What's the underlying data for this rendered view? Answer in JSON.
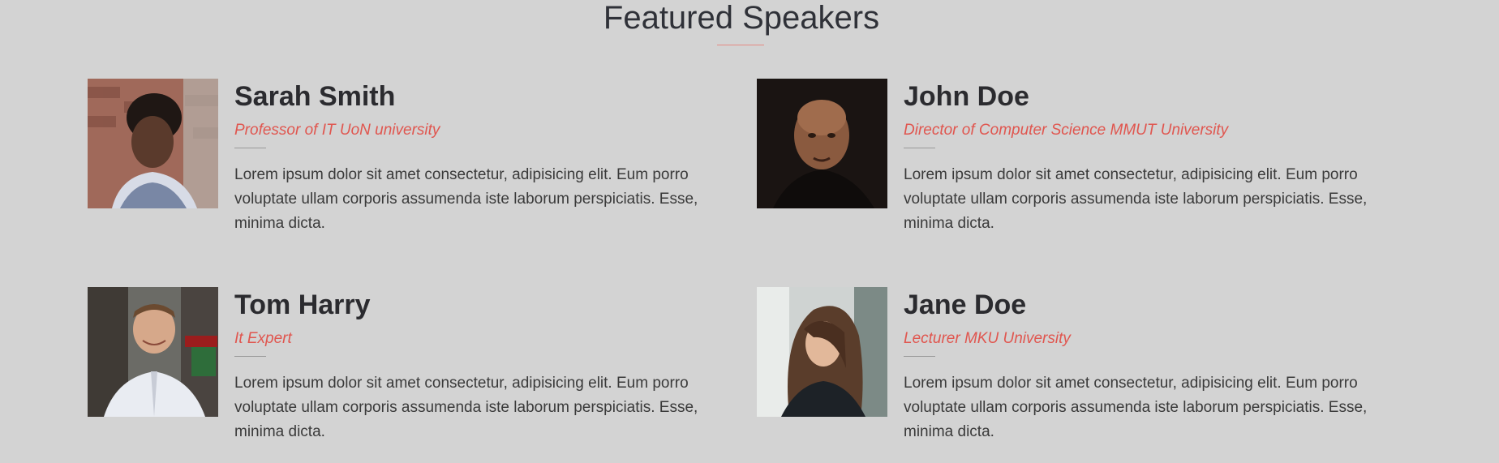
{
  "section": {
    "title": "Featured Speakers"
  },
  "speakers": [
    {
      "name": "Sarah Smith",
      "role": "Professor of IT UoN university",
      "bio": "Lorem ipsum dolor sit amet consectetur, adipisicing elit. Eum porro voluptate ullam corporis assumenda iste laborum perspiciatis. Esse, minima dicta."
    },
    {
      "name": "John Doe",
      "role": "Director of Computer Science MMUT University",
      "bio": "Lorem ipsum dolor sit amet consectetur, adipisicing elit. Eum porro voluptate ullam corporis assumenda iste laborum perspiciatis. Esse, minima dicta."
    },
    {
      "name": "Tom Harry",
      "role": "It Expert",
      "bio": "Lorem ipsum dolor sit amet consectetur, adipisicing elit. Eum porro voluptate ullam corporis assumenda iste laborum perspiciatis. Esse, minima dicta."
    },
    {
      "name": "Jane Doe",
      "role": "Lecturer MKU University",
      "bio": "Lorem ipsum dolor sit amet consectetur, adipisicing elit. Eum porro voluptate ullam corporis assumenda iste laborum perspiciatis. Esse, minima dicta."
    }
  ],
  "colors": {
    "background": "#d3d3d3",
    "accent": "#e0564f",
    "heading": "#2b2b2f"
  }
}
